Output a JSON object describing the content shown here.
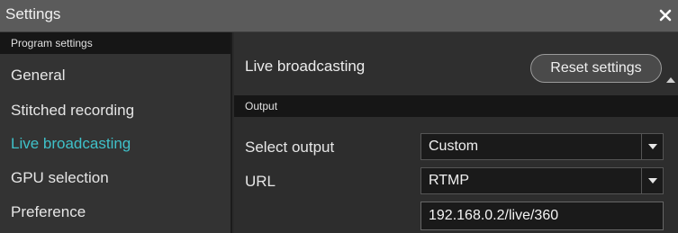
{
  "window": {
    "title": "Settings",
    "close_icon": "close-icon"
  },
  "sidebar": {
    "section_header": "Program settings",
    "items": [
      {
        "label": "General",
        "active": false
      },
      {
        "label": "Stitched recording",
        "active": false
      },
      {
        "label": "Live broadcasting",
        "active": true
      },
      {
        "label": "GPU selection",
        "active": false
      },
      {
        "label": "Preference",
        "active": false
      }
    ],
    "accent_color": "#3fc1c9"
  },
  "main": {
    "heading": "Live broadcasting",
    "reset_button": "Reset settings",
    "output_section": "Output",
    "select_output": {
      "label": "Select output",
      "value": "Custom"
    },
    "url": {
      "label": "URL",
      "protocol": "RTMP",
      "address": "192.168.0.2/live/360"
    }
  }
}
